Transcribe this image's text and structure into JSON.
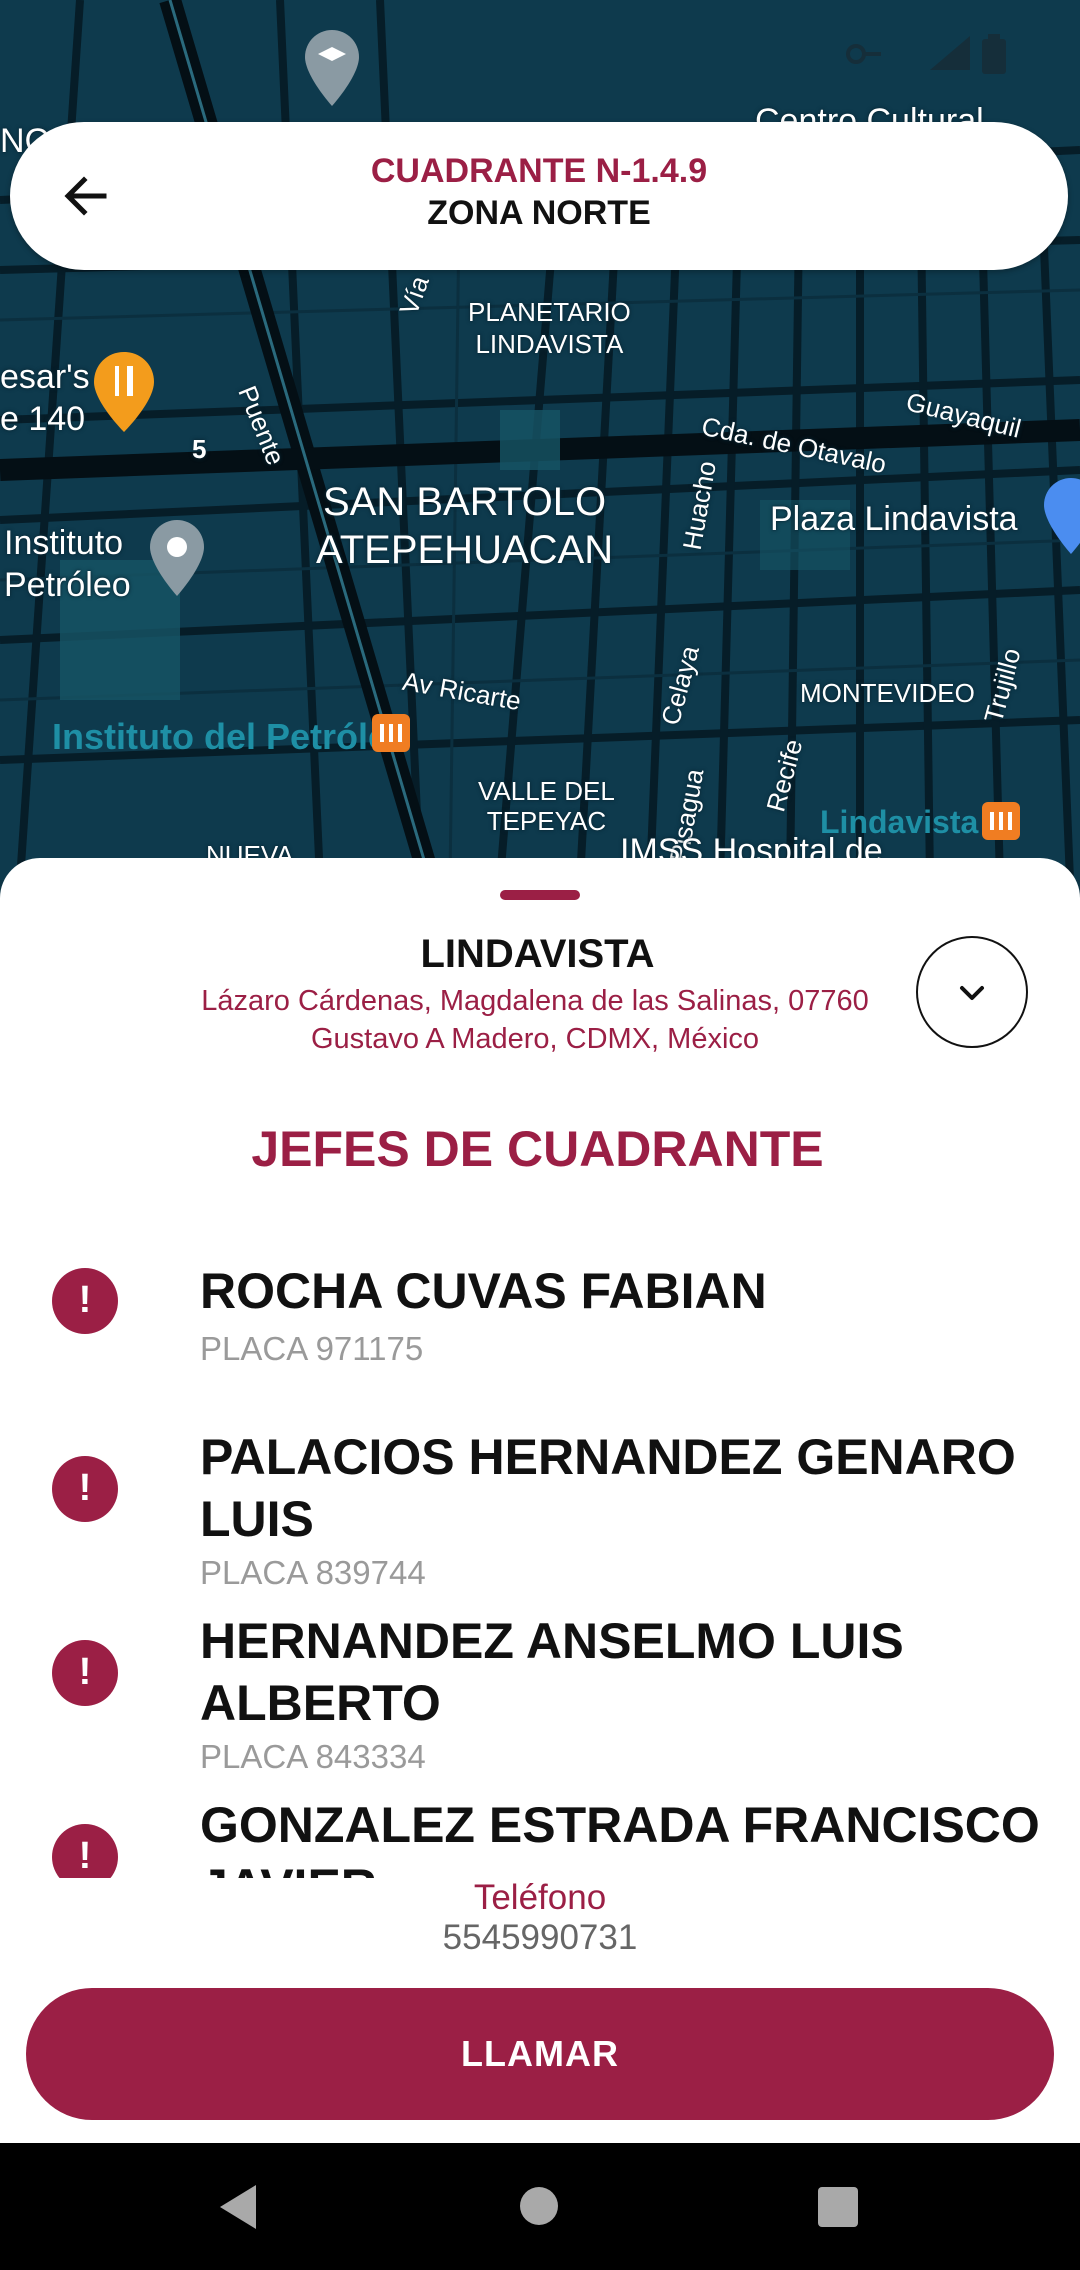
{
  "map": {
    "labels": {
      "planetario": "PLANETARIO\nLINDAVISTA",
      "san_bartolo": "SAN BARTOLO\nATEPEHUACAN",
      "plaza": "Plaza Lindavista",
      "instituto": "Instituto\nPetróleo",
      "cesars": "esar's\ne 140",
      "puente": "Puente",
      "via": "Vía",
      "cda_otavalo": "Cda. de Otavalo",
      "guayaquil": "Guayaquil",
      "huacho": "Huacho",
      "av_ricarte": "Av Ricarte",
      "celaya": "Celaya",
      "montevideo": "MONTEVIDEO",
      "trujillo": "Trujillo",
      "recife": "Recife",
      "pisagua": "Pisagua",
      "valle_tepeyac": "VALLE DEL\nTEPEYAC",
      "instituto_metro": "Instituto del Petróleo",
      "lindavista_metro": "Lindavista",
      "imss": "IMSS Hospital de",
      "nueva": "NUEVA",
      "five": "5",
      "ncl": "NC\nle",
      "cultural": "Centro Cultural"
    }
  },
  "header": {
    "title": "CUADRANTE N-1.4.9",
    "subtitle": "ZONA NORTE"
  },
  "place": {
    "name": "LINDAVISTA",
    "address": "Lázaro Cárdenas, Magdalena de las Salinas, 07760 Gustavo A Madero, CDMX, México"
  },
  "section_title": "JEFES DE CUADRANTE",
  "chiefs": [
    {
      "name": "ROCHA CUVAS FABIAN",
      "placa": "PLACA 971175"
    },
    {
      "name": "PALACIOS HERNANDEZ GENARO LUIS",
      "placa": "PLACA 839744"
    },
    {
      "name": "HERNANDEZ ANSELMO LUIS ALBERTO",
      "placa": "PLACA 843334"
    },
    {
      "name": "GONZALEZ ESTRADA FRANCISCO JAVIER",
      "placa": ""
    }
  ],
  "phone": {
    "label": "Teléfono",
    "value": "5545990731"
  },
  "call_button": "LLAMAR",
  "colors": {
    "accent": "#9b1f45",
    "map_bg": "#0e3a4d"
  }
}
